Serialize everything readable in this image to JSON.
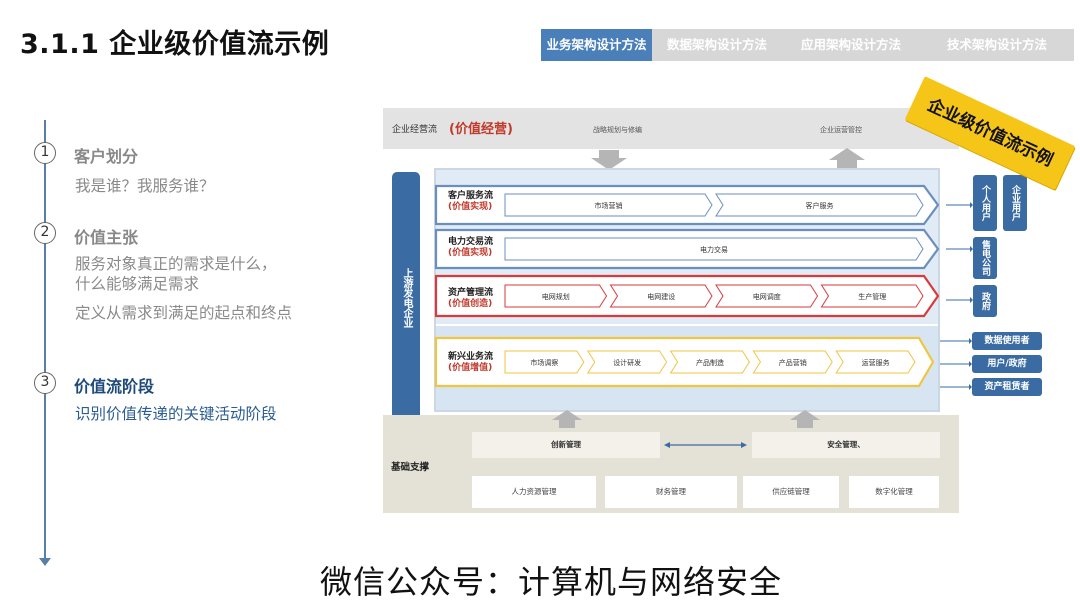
{
  "title": "3.1.1 企业级价值流示例",
  "tabs": [
    "业务架构设计方法",
    "数据架构设计方法",
    "应用架构设计方法",
    "技术架构设计方法"
  ],
  "steps": [
    {
      "num": "1",
      "title": "客户划分",
      "desc": [
        "我是谁？我服务谁？"
      ]
    },
    {
      "num": "2",
      "title": "价值主张",
      "desc": [
        "服务对象真正的需求是什么，",
        "什么能够满足需求",
        "定义从需求到满足的起点和终点"
      ]
    },
    {
      "num": "3",
      "title": "价值流阶段",
      "desc": [
        "识别价值传递的关键活动阶段"
      ]
    }
  ],
  "diagram": {
    "top": {
      "label": "企业经营流",
      "value": "(价值经营)",
      "left": "战略规划与修编",
      "right": "企业运营管控"
    },
    "upstream": "上游发电企业",
    "flows": [
      {
        "name": "客户服务流",
        "sub": "(价值实现)",
        "stages": [
          "市场营销",
          "客户服务"
        ],
        "color": "#6a8fbf"
      },
      {
        "name": "电力交易流",
        "sub": "(价值实现)",
        "stages": [
          "电力交易"
        ],
        "color": "#6a8fbf"
      },
      {
        "name": "资产管理流",
        "sub": "(价值创造)",
        "stages": [
          "电网规划",
          "电网建设",
          "电网调度",
          "生产管理"
        ],
        "color": "#d93a3a"
      },
      {
        "name": "新兴业务流",
        "sub": "(价值增值)",
        "stages": [
          "市场调察",
          "设计研发",
          "产品制造",
          "产品营销",
          "运营服务"
        ],
        "color": "#f0c542"
      }
    ],
    "right_tags": [
      "个人用户",
      "企业用户",
      "售电公司",
      "政府",
      "数据使用者",
      "用户/政府",
      "资产租赁者"
    ],
    "base": {
      "label": "基础支撑",
      "row1": [
        "创新管理",
        "安全管理、"
      ],
      "row2": [
        "人力资源管理",
        "财务管理",
        "供应链管理",
        "数字化管理"
      ]
    }
  },
  "stamp": "企业级价值流示例",
  "footer": "微信公众号：计算机与网络安全"
}
